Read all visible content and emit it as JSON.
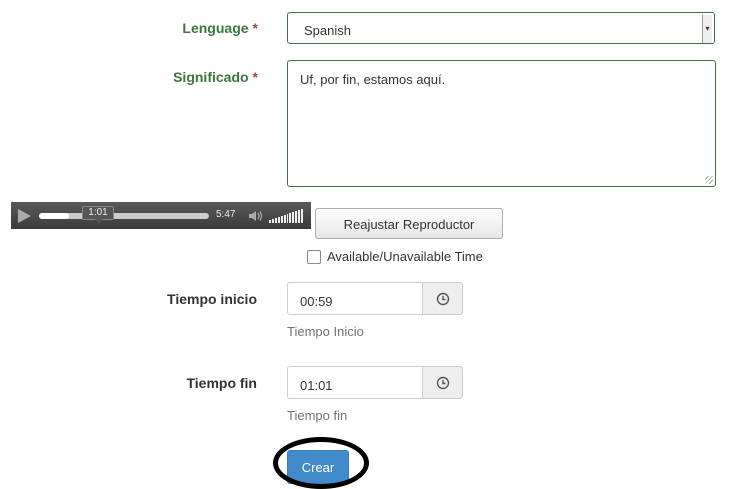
{
  "form": {
    "language": {
      "label": "Lenguage",
      "required_mark": "*",
      "value": "Spanish"
    },
    "meaning": {
      "label": "Significado",
      "required_mark": "*",
      "value": "Uf, por fin, estamos aquí."
    },
    "player": {
      "current_time": "1:01",
      "duration": "5:47",
      "progress_fraction": 0.176
    },
    "reset_button_label": "Reajustar Reproductor",
    "available_checkbox_label": "Available/Unavailable Time",
    "start_time": {
      "label": "Tiempo inicio",
      "value": "00:59",
      "help": "Tiempo Inicio"
    },
    "end_time": {
      "label": "Tiempo fin",
      "value": "01:01",
      "help": "Tiempo fin"
    },
    "submit_label": "Crear"
  },
  "colors": {
    "success_green": "#3c763d",
    "primary_blue": "#428bca",
    "required_red": "#a94442"
  }
}
